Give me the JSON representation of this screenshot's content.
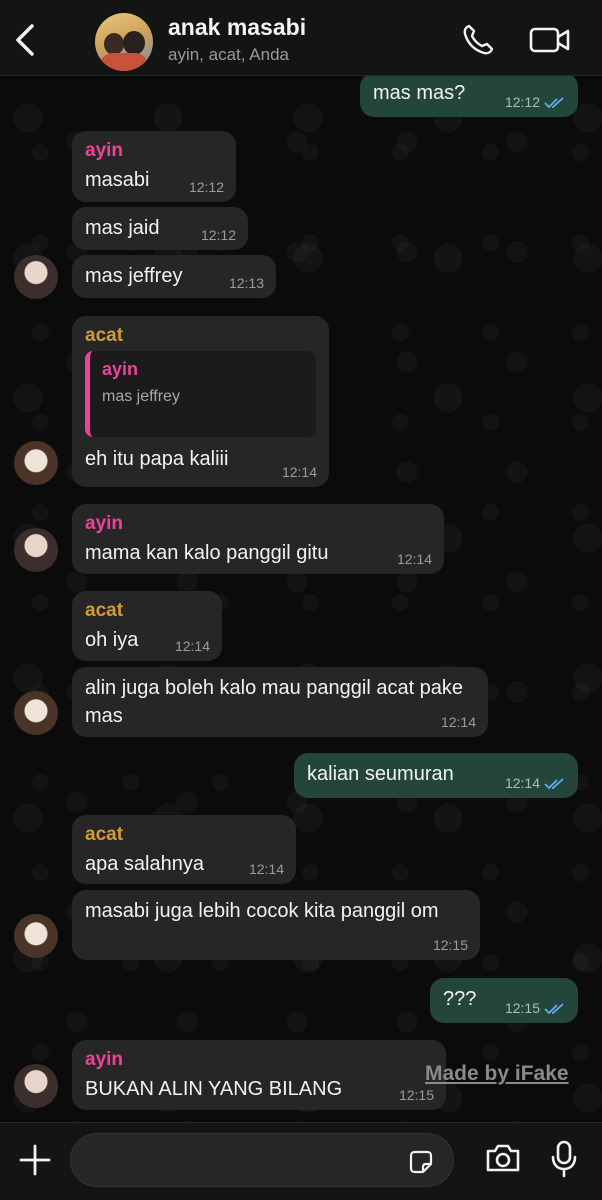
{
  "header": {
    "title": "anak masabi",
    "subtitle": "ayin, acat, Anda"
  },
  "colors": {
    "ayin": "#f0419a",
    "acat": "#d39a3b",
    "outgoing_bubble": "#24463a",
    "incoming_bubble": "#262626"
  },
  "messages": [
    {
      "dir": "out",
      "text": "mas mas?",
      "time": "12:12",
      "status": "read"
    },
    {
      "dir": "in",
      "sender": "ayin",
      "text": "masabi",
      "time": "12:12"
    },
    {
      "dir": "in",
      "sender": "ayin",
      "text": "mas jaid",
      "time": "12:12"
    },
    {
      "dir": "in",
      "sender": "ayin",
      "text": "mas jeffrey",
      "time": "12:13"
    },
    {
      "dir": "in",
      "sender": "acat",
      "quote_name": "ayin",
      "quote_text": "mas jeffrey",
      "text": "eh itu papa kaliii",
      "time": "12:14"
    },
    {
      "dir": "in",
      "sender": "ayin",
      "text": "mama kan kalo panggil gitu",
      "time": "12:14"
    },
    {
      "dir": "in",
      "sender": "acat",
      "text": "oh iya",
      "time": "12:14"
    },
    {
      "dir": "in",
      "sender": "acat",
      "text": "alin juga boleh kalo mau panggil acat pake mas",
      "time": "12:14"
    },
    {
      "dir": "out",
      "text": "kalian seumuran",
      "time": "12:14",
      "status": "read"
    },
    {
      "dir": "in",
      "sender": "acat",
      "text": "apa salahnya",
      "time": "12:14"
    },
    {
      "dir": "in",
      "sender": "acat",
      "text": "masabi juga lebih cocok kita panggil om",
      "time": "12:15"
    },
    {
      "dir": "out",
      "text": "???",
      "time": "12:15",
      "status": "read"
    },
    {
      "dir": "in",
      "sender": "ayin",
      "text": "BUKAN ALIN YANG BILANG",
      "time": "12:15"
    }
  ],
  "watermark": "Made by iFake",
  "icons": {
    "back": "chevron-left-icon",
    "call": "phone-icon",
    "video": "video-camera-icon",
    "attach": "plus-icon",
    "sticker": "sticker-icon",
    "camera": "camera-icon",
    "mic": "microphone-icon"
  }
}
